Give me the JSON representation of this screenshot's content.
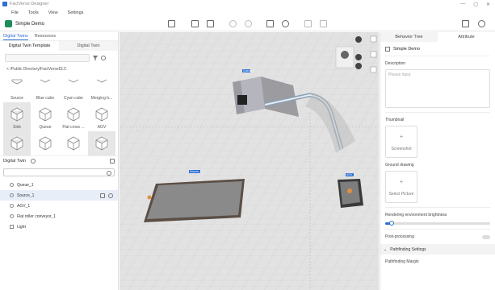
{
  "window": {
    "title": "FactVerse Designer",
    "controls": [
      "—",
      "▢",
      "✕"
    ]
  },
  "menu": [
    "File",
    "Tools",
    "View",
    "Settings"
  ],
  "toolbar": {
    "app_title": "Simple Demo"
  },
  "left_panel": {
    "tabs": [
      "Digital Twins",
      "Resources"
    ],
    "subtabs": [
      "Digital Twin Template",
      "Digital Twin"
    ],
    "path": "< /Public Directory/FactVerseDLC",
    "templates_row1": [
      "Source",
      "Blue cube",
      "Cyan cube",
      "Merging b..."
    ],
    "templates_row2": [
      "Sink",
      "Queue",
      "Flat cross ...",
      "AGV"
    ],
    "digital_twin_header": "Digital Twin",
    "tree": [
      "Queue_1",
      "Source_1",
      "AGV_1",
      "Flat roller conveyor_1",
      "Light"
    ]
  },
  "right_panel": {
    "tabs": [
      "Behavior Tree",
      "Attribute"
    ],
    "name": "Simple Demo",
    "description_label": "Description",
    "description_placeholder": "Please input",
    "thumbnail_label": "Thumbnail",
    "screenshot_label": "Screenshot",
    "ground_label": "Ground drawing",
    "select_picture_label": "Select Picture",
    "brightness_label": "Rendering environment brightness",
    "brightness_value": 0.06,
    "post_processing_label": "Post-processing",
    "pathfinding_settings_label": "Pathfinding Settings",
    "pathfinding_margin_label": "Pathfinding Margin"
  },
  "viewport": {
    "labels": [
      "Source_1",
      "Queue_1",
      "AGV_1"
    ]
  },
  "colors": {
    "accent": "#2d6fd6",
    "brand": "#1a8d5b",
    "selection": "#e8eef8"
  }
}
